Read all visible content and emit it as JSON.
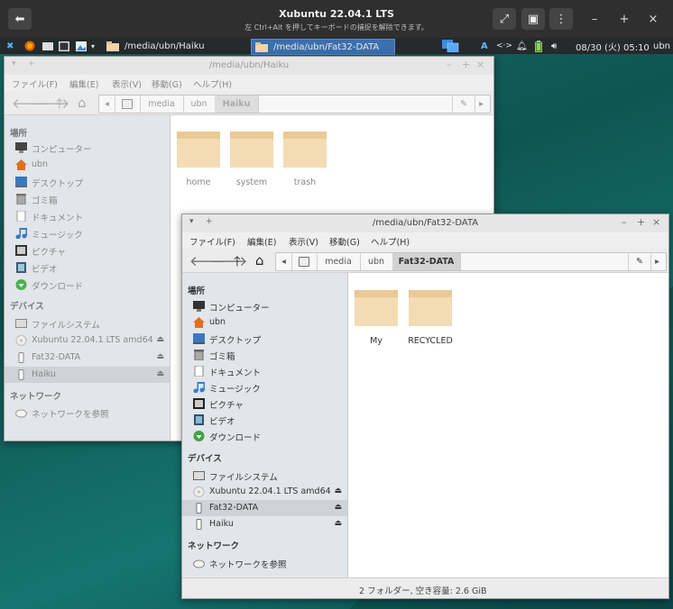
{
  "vm": {
    "title": "Xubuntu 22.04.1 LTS",
    "subtitle": "左 Ctrl+Alt を押してキーボードの捕捉を解除できます。"
  },
  "panel": {
    "tasks": [
      "/media/ubn/Haiku",
      "/media/ubn/Fat32-DATA"
    ],
    "input_method": "A",
    "datetime": "08/30 (火) 05:10",
    "user": "ubn"
  },
  "windows": {
    "back": {
      "title": "/media/ubn/Haiku",
      "breadcrumbs": [
        "media",
        "ubn",
        "Haiku"
      ],
      "folders": [
        "home",
        "system",
        "trash"
      ]
    },
    "front": {
      "title": "/media/ubn/Fat32-DATA",
      "breadcrumbs": [
        "media",
        "ubn",
        "Fat32-DATA"
      ],
      "folders": [
        "My",
        "RECYCLED"
      ],
      "status": "2 フォルダー, 空き容量: 2.6 GiB"
    }
  },
  "menu": [
    "ファイル(F)",
    "編集(E)",
    "表示(V)",
    "移動(G)",
    "ヘルプ(H)"
  ],
  "sidebar": {
    "places_header": "場所",
    "places": [
      "コンピューター",
      "ubn",
      "デスクトップ",
      "ゴミ箱",
      "ドキュメント",
      "ミュージック",
      "ピクチャ",
      "ビデオ",
      "ダウンロード"
    ],
    "devices_header": "デバイス",
    "devices": [
      "ファイルシステム",
      "Xubuntu 22.04.1 LTS amd64",
      "Fat32-DATA",
      "Haiku"
    ],
    "network_header": "ネットワーク",
    "network": [
      "ネットワークを参照"
    ]
  },
  "colors": {
    "accent": "#2f7fd0",
    "folder": "#f0d5a8",
    "desktop": "#146663"
  }
}
